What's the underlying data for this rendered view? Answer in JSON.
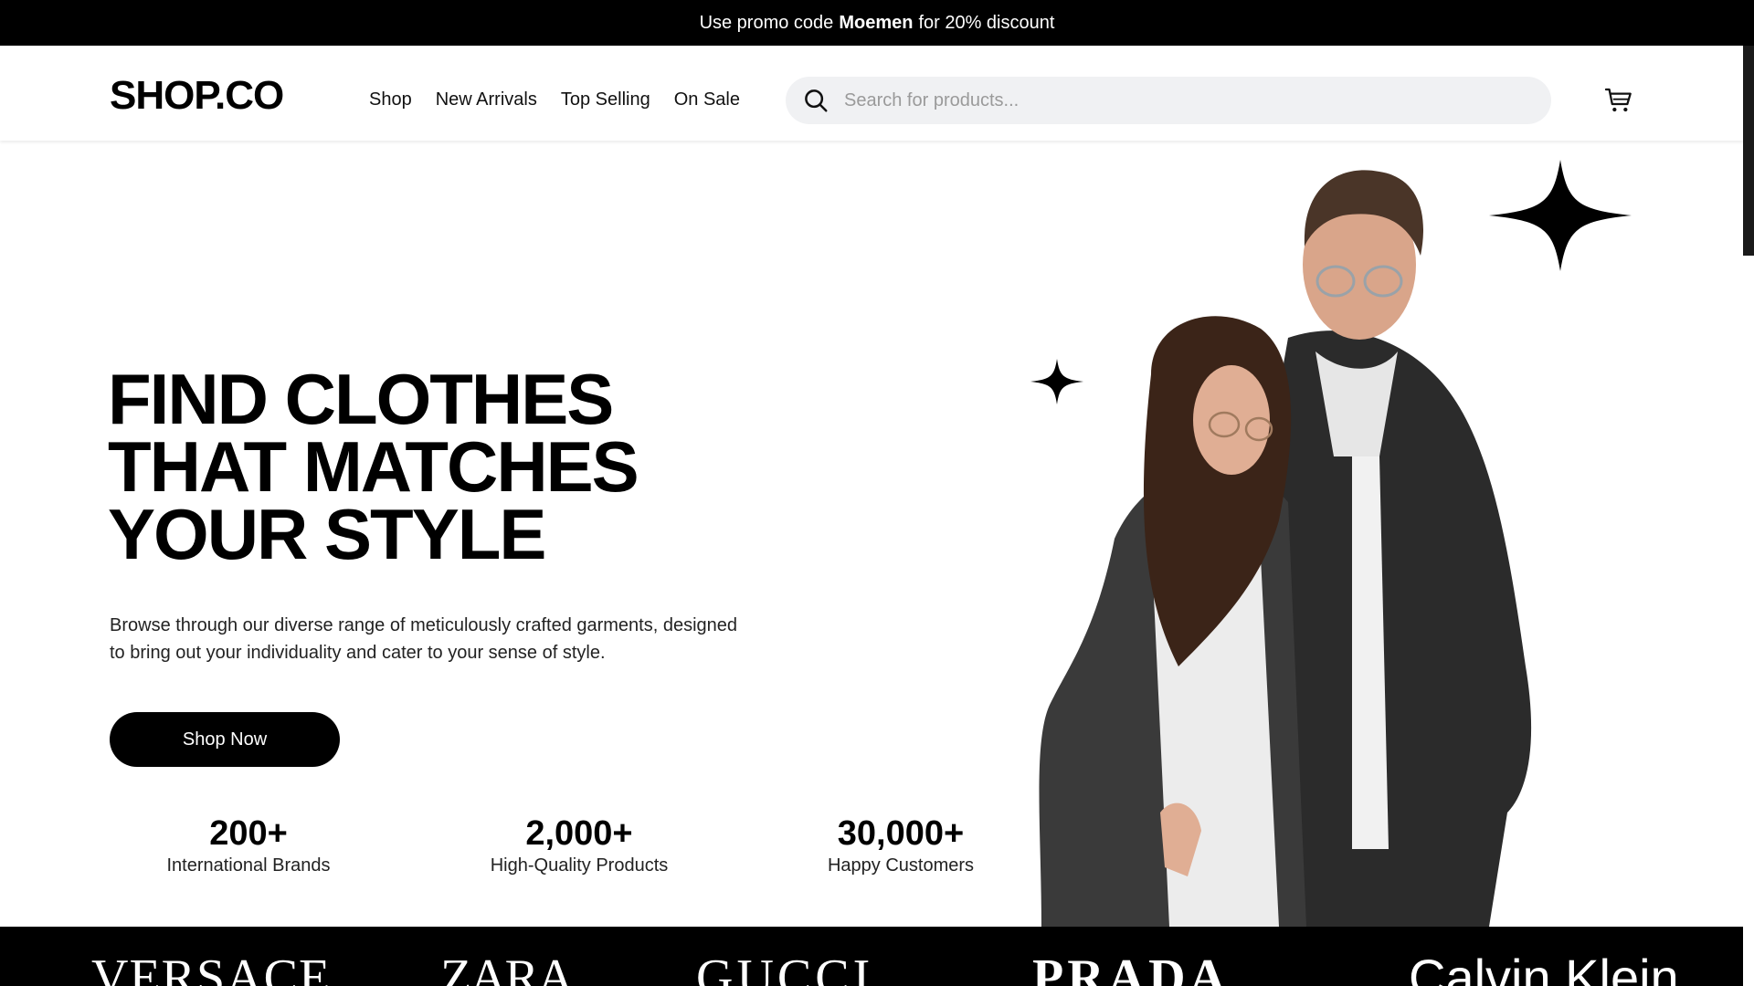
{
  "promo": {
    "prefix": "Use promo code",
    "code": "Moemen",
    "suffix": "for 20% discount"
  },
  "header": {
    "logo": "SHOP.CO",
    "nav": [
      "Shop",
      "New Arrivals",
      "Top Selling",
      "On Sale"
    ],
    "search_placeholder": "Search for products..."
  },
  "hero": {
    "headline": [
      "FIND CLOTHES",
      "THAT MATCHES",
      "YOUR STYLE"
    ],
    "description_line1": "Browse through our diverse range of meticulously crafted garments, designed",
    "description_line2": "to bring out your individuality and cater to your sense of style.",
    "cta": "Shop Now",
    "stats": [
      {
        "value": "200+",
        "label": "International Brands"
      },
      {
        "value": "2,000+",
        "label": "High-Quality Products"
      },
      {
        "value": "30,000+",
        "label": "Happy Customers"
      }
    ]
  },
  "brands": [
    "VERSACE",
    "ZARA",
    "GUCCI",
    "PRADA",
    "Calvin Klein"
  ],
  "icons": {
    "search": "search-icon",
    "cart": "cart-icon",
    "stars": "sparkle-icon"
  },
  "colors": {
    "primary": "#000000",
    "background": "#ffffff",
    "search_bg": "#f0f1f3"
  }
}
